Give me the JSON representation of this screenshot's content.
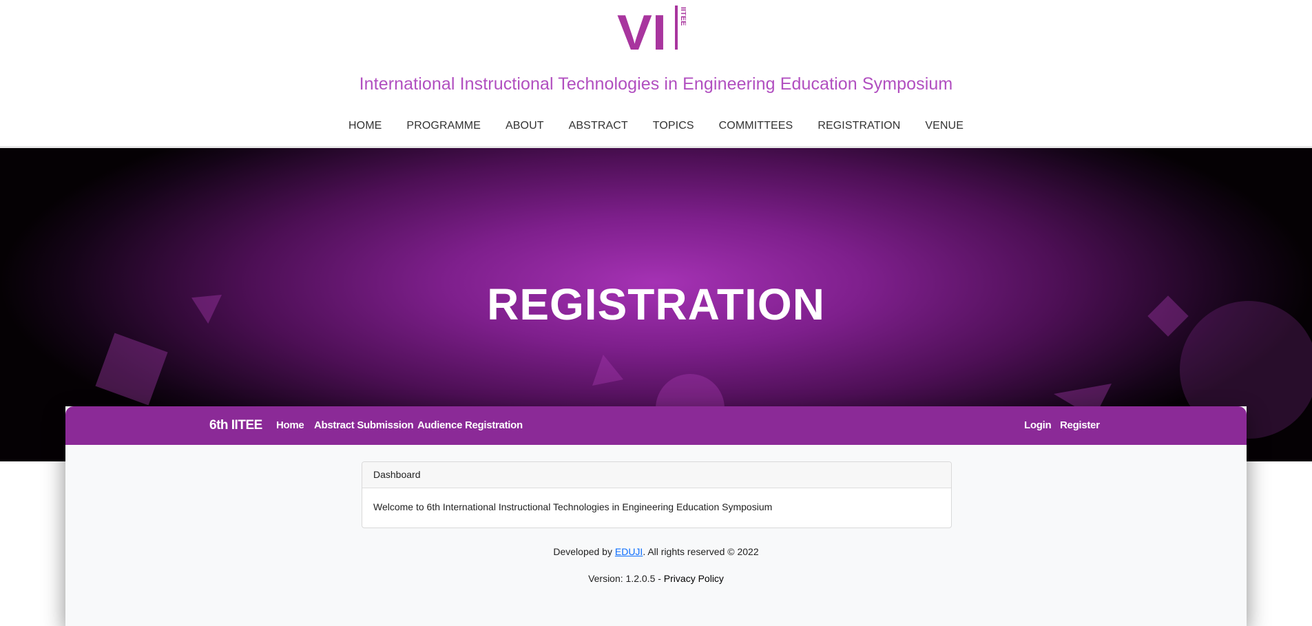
{
  "header": {
    "logo_text": "VI",
    "logo_side_text": "IITEE",
    "site_title": "International Instructional Technologies in Engineering Education Symposium",
    "nav": [
      {
        "label": "HOME"
      },
      {
        "label": "PROGRAMME"
      },
      {
        "label": "ABOUT"
      },
      {
        "label": "ABSTRACT"
      },
      {
        "label": "TOPICS"
      },
      {
        "label": "COMMITTEES"
      },
      {
        "label": "REGISTRATION"
      },
      {
        "label": "VENUE"
      }
    ]
  },
  "hero": {
    "title": "REGISTRATION"
  },
  "appbar": {
    "brand": "6th IITEE",
    "links": [
      "Home",
      "Abstract Submission",
      "Audience Registration"
    ],
    "login": "Login",
    "register": "Register"
  },
  "card": {
    "header": "Dashboard",
    "body": "Welcome to 6th International Instructional Technologies in Engineering Education Symposium"
  },
  "footer": {
    "developed_prefix": "Developed by ",
    "developer_link": "EDUJI",
    "developed_suffix": ". All rights reserved © 2022",
    "version_text": "Version: 1.2.0.5 - ",
    "privacy_link": "Privacy Policy"
  },
  "colors": {
    "brand_purple": "#8b2a97",
    "title_purple": "#b14fc0"
  }
}
